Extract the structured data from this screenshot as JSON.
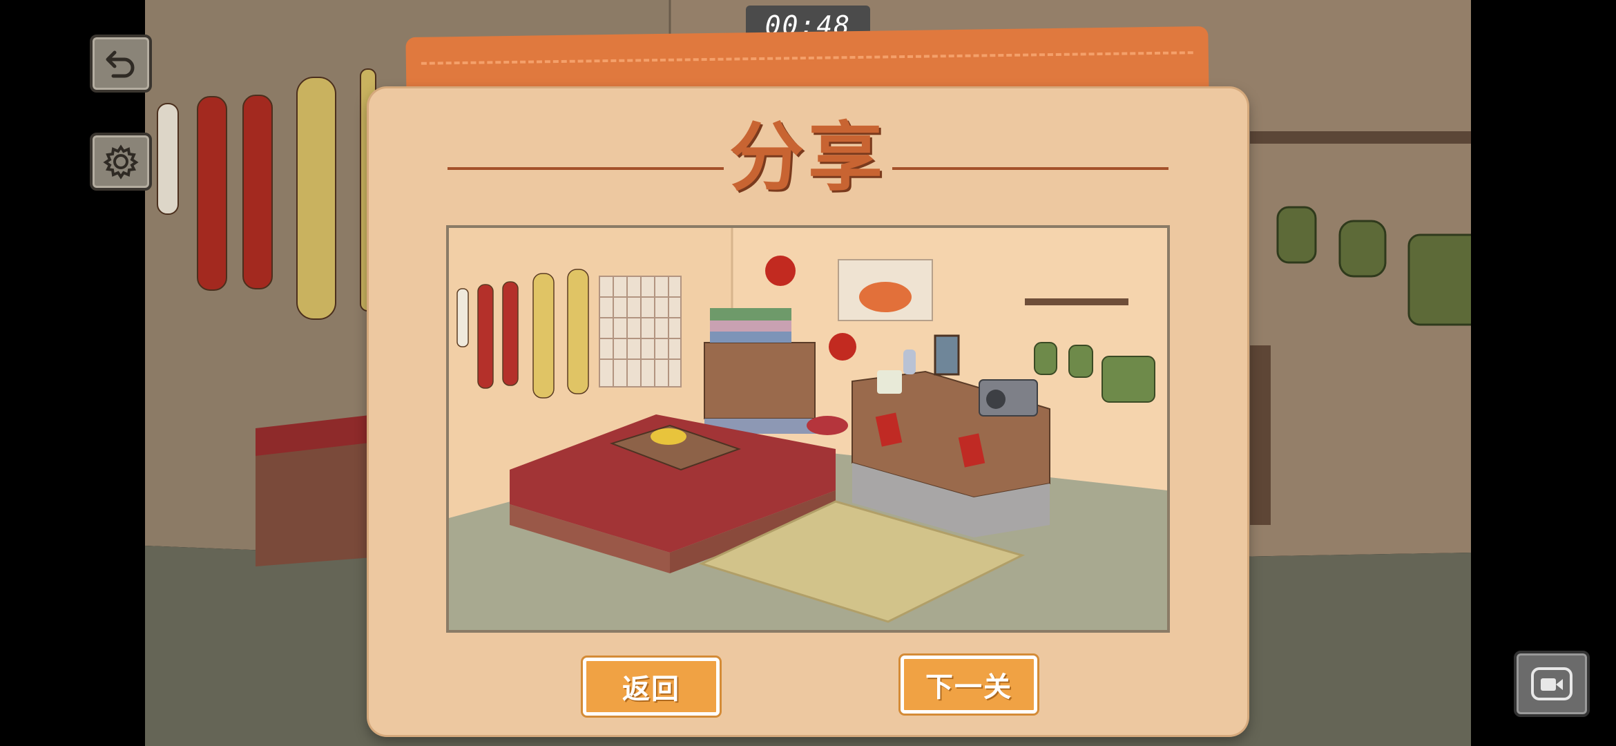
{
  "timer": {
    "text": "00:48"
  },
  "toolbar": {
    "undo_icon": "undo-icon",
    "settings_icon": "gear-icon",
    "record_icon": "video-record-icon"
  },
  "dialog": {
    "title": "分享",
    "back_label": "返回",
    "next_label": "下一关"
  },
  "colors": {
    "dialog_bg": "#edc8a0",
    "title": "#c86432",
    "button": "#f0a244",
    "tab": "#e0793e"
  }
}
